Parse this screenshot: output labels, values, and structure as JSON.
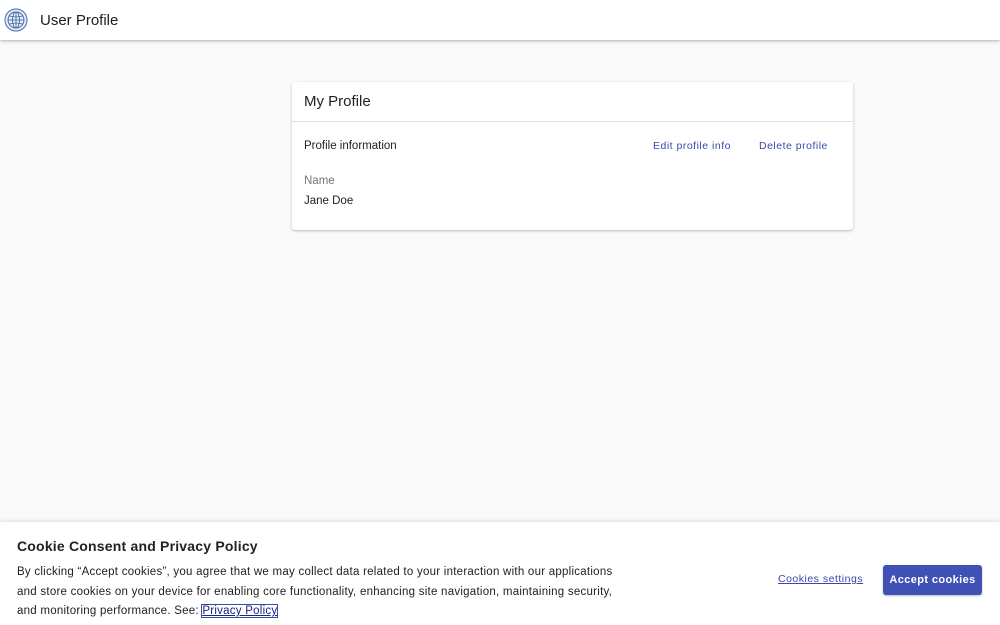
{
  "app": {
    "title": "User Profile",
    "logo_icon": "globe-icon"
  },
  "profile_card": {
    "title": "My Profile",
    "section_title": "Profile information",
    "edit_label": "Edit profile info",
    "delete_label": "Delete profile",
    "name_label": "Name",
    "name_value": "Jane Doe"
  },
  "cookie_banner": {
    "title": "Cookie Consent and Privacy Policy",
    "text": "By clicking “Accept cookies”, you agree that we may collect data related to your interaction with our applications and store cookies on your device for enabling core functionality, enhancing site navigation, maintaining security, and monitoring performance. See: ",
    "privacy_link": "Privacy Policy",
    "settings_label": "Cookies settings",
    "accept_label": "Accept cookies"
  },
  "colors": {
    "accent": "#3f51b5",
    "link": "#3949ab",
    "background": "#fafafa"
  }
}
